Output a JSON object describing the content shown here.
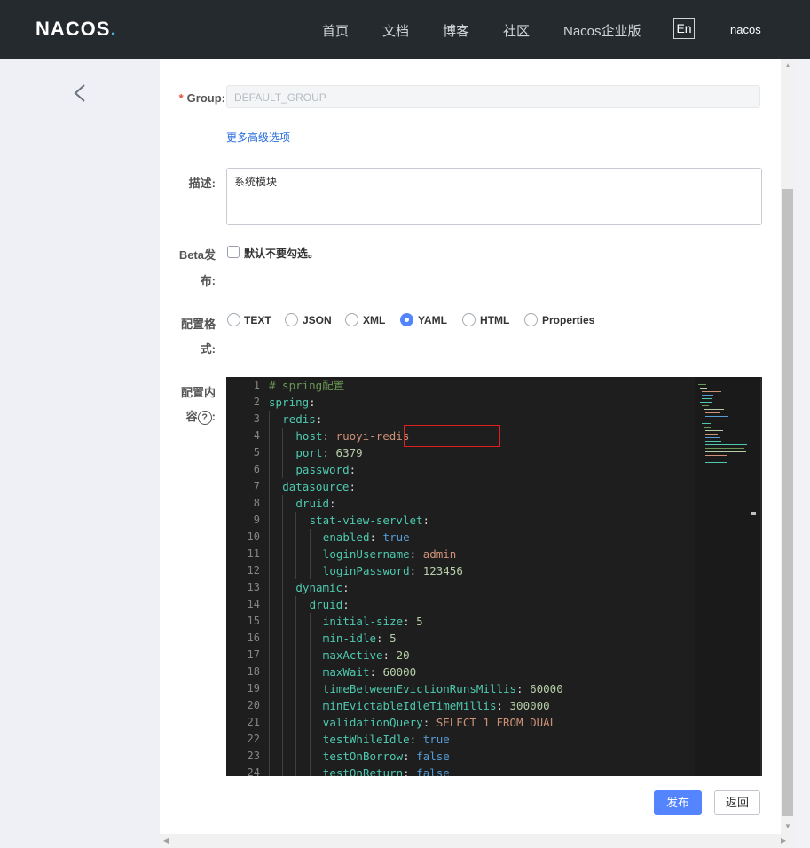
{
  "nav": {
    "logo": "NACOS",
    "items": [
      "首页",
      "文档",
      "博客",
      "社区",
      "Nacos企业版"
    ],
    "lang": "En",
    "user": "nacos"
  },
  "form": {
    "group_label": "Group:",
    "group_value": "DEFAULT_GROUP",
    "advanced_link": "更多高级选项",
    "desc_label": "描述:",
    "desc_value": "系统模块",
    "beta_label_1": "Beta发",
    "beta_label_2": "布:",
    "beta_checkbox": "默认不要勾选。",
    "format_label_1": "配置格",
    "format_label_2": "式:",
    "formats": [
      "TEXT",
      "JSON",
      "XML",
      "YAML",
      "HTML",
      "Properties"
    ],
    "selected_format": "YAML",
    "content_label_1": "配置内",
    "content_label_2": "容",
    "publish_button": "发布",
    "back_button": "返回"
  },
  "editor": {
    "lines": [
      {
        "n": "1",
        "indent": 0,
        "comment": "# spring配置"
      },
      {
        "n": "2",
        "indent": 0,
        "key": "spring"
      },
      {
        "n": "3",
        "indent": 1,
        "key": "redis"
      },
      {
        "n": "4",
        "indent": 2,
        "key": "host",
        "value": "ruoyi-redis",
        "vt": "str"
      },
      {
        "n": "5",
        "indent": 2,
        "key": "port",
        "value": "6379",
        "vt": "num"
      },
      {
        "n": "6",
        "indent": 2,
        "key": "password"
      },
      {
        "n": "7",
        "indent": 1,
        "key": "datasource"
      },
      {
        "n": "8",
        "indent": 2,
        "key": "druid"
      },
      {
        "n": "9",
        "indent": 3,
        "key": "stat-view-servlet"
      },
      {
        "n": "10",
        "indent": 4,
        "key": "enabled",
        "value": "true",
        "vt": "bool"
      },
      {
        "n": "11",
        "indent": 4,
        "key": "loginUsername",
        "value": "admin",
        "vt": "str"
      },
      {
        "n": "12",
        "indent": 4,
        "key": "loginPassword",
        "value": "123456",
        "vt": "num"
      },
      {
        "n": "13",
        "indent": 2,
        "key": "dynamic"
      },
      {
        "n": "14",
        "indent": 3,
        "key": "druid"
      },
      {
        "n": "15",
        "indent": 4,
        "key": "initial-size",
        "value": "5",
        "vt": "num"
      },
      {
        "n": "16",
        "indent": 4,
        "key": "min-idle",
        "value": "5",
        "vt": "num"
      },
      {
        "n": "17",
        "indent": 4,
        "key": "maxActive",
        "value": "20",
        "vt": "num"
      },
      {
        "n": "18",
        "indent": 4,
        "key": "maxWait",
        "value": "60000",
        "vt": "num"
      },
      {
        "n": "19",
        "indent": 4,
        "key": "timeBetweenEvictionRunsMillis",
        "value": "60000",
        "vt": "num"
      },
      {
        "n": "20",
        "indent": 4,
        "key": "minEvictableIdleTimeMillis",
        "value": "300000",
        "vt": "num"
      },
      {
        "n": "21",
        "indent": 4,
        "key": "validationQuery",
        "value": "SELECT 1 FROM DUAL",
        "vt": "str"
      },
      {
        "n": "22",
        "indent": 4,
        "key": "testWhileIdle",
        "value": "true",
        "vt": "bool"
      },
      {
        "n": "23",
        "indent": 4,
        "key": "testOnBorrow",
        "value": "false",
        "vt": "bool"
      },
      {
        "n": "24",
        "indent": 4,
        "key": "testOnReturn",
        "value": "false",
        "vt": "bool"
      }
    ]
  },
  "colors": {
    "topbar": "#252a2f",
    "primary": "#5584ff",
    "required": "#e3503c",
    "highlight_box": "#e0201c"
  }
}
